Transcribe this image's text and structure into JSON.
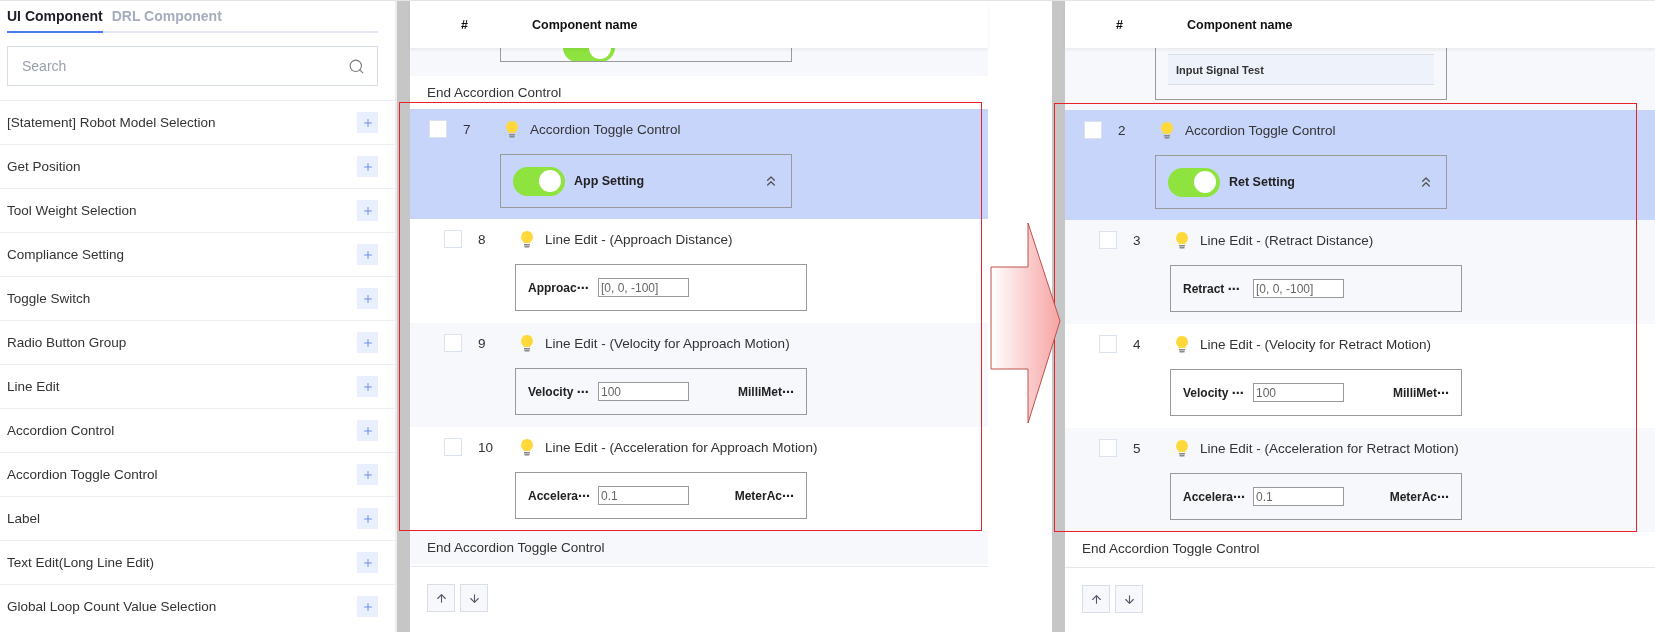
{
  "sidebar": {
    "tabs": [
      {
        "label": "UI Component",
        "selected": true
      },
      {
        "label": "DRL Component",
        "selected": false
      }
    ],
    "search": {
      "placeholder": "Search"
    },
    "items": [
      {
        "label": "[Statement] Robot Model Selection"
      },
      {
        "label": "Get Position"
      },
      {
        "label": "Tool Weight Selection"
      },
      {
        "label": "Compliance Setting"
      },
      {
        "label": "Toggle Switch"
      },
      {
        "label": "Radio Button Group"
      },
      {
        "label": "Line Edit"
      },
      {
        "label": "Accordion Control"
      },
      {
        "label": "Accordion Toggle Control"
      },
      {
        "label": "Label"
      },
      {
        "label": "Text Edit(Long Line Edit)"
      },
      {
        "label": "Global Loop Count Value Selection"
      }
    ]
  },
  "panels": [
    {
      "columns": [
        "#",
        "Component name"
      ],
      "fragment": {
        "kind": "toggle",
        "on": true
      },
      "rows": [
        {
          "kind": "end",
          "text": "End Accordion Control"
        },
        {
          "kind": "accordion",
          "number": "7",
          "title": "Accordion Toggle Control",
          "selected": true,
          "checked": false,
          "highlighted": true,
          "expanded": true,
          "toggle": {
            "label": "App Setting",
            "on": true
          },
          "children": [
            {
              "kind": "line_edit",
              "number": "8",
              "title": "Line Edit - (Approach Distance)",
              "selected": false,
              "checked": false,
              "field_label": "Approac⋯",
              "value": "[0, 0, -100]"
            },
            {
              "kind": "line_edit",
              "number": "9",
              "title": "Line Edit - (Velocity for Approach Motion)",
              "selected": false,
              "checked": false,
              "field_label": "Velocity ⋯",
              "value": "100",
              "unit": "MilliMet⋯"
            },
            {
              "kind": "line_edit",
              "number": "10",
              "title": "Line Edit - (Acceleration for Approach Motion)",
              "selected": false,
              "checked": false,
              "field_label": "Accelera⋯",
              "value": "0.1",
              "unit": "MeterAc⋯"
            }
          ]
        },
        {
          "kind": "end",
          "text": "End Accordion Toggle Control"
        }
      ]
    },
    {
      "columns": [
        "#",
        "Component name"
      ],
      "fragment": {
        "kind": "label",
        "text": "Input Signal Test"
      },
      "rows": [
        {
          "kind": "accordion",
          "number": "2",
          "title": "Accordion Toggle Control",
          "selected": true,
          "checked": false,
          "highlighted": true,
          "expanded": true,
          "toggle": {
            "label": "Ret Setting",
            "on": true
          },
          "children": [
            {
              "kind": "line_edit",
              "number": "3",
              "title": "Line Edit - (Retract Distance)",
              "selected": false,
              "checked": false,
              "field_label": "Retract ⋯",
              "value": "[0, 0, -100]"
            },
            {
              "kind": "line_edit",
              "number": "4",
              "title": "Line Edit - (Velocity for Retract Motion)",
              "selected": false,
              "checked": false,
              "field_label": "Velocity ⋯",
              "value": "100",
              "unit": "MilliMet⋯"
            },
            {
              "kind": "line_edit",
              "number": "5",
              "title": "Line Edit - (Acceleration for Retract Motion)",
              "selected": false,
              "checked": false,
              "field_label": "Accelera⋯",
              "value": "0.1",
              "unit": "MeterAc⋯"
            }
          ]
        },
        {
          "kind": "end",
          "text": "End Accordion Toggle Control"
        }
      ]
    }
  ],
  "arrow": true
}
